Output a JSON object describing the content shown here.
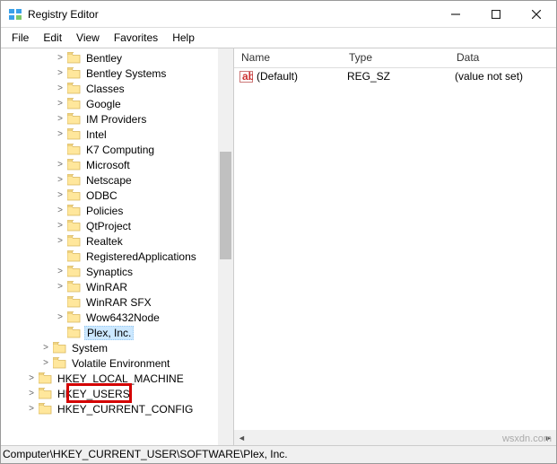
{
  "window": {
    "title": "Registry Editor"
  },
  "menubar": {
    "file": "File",
    "edit": "Edit",
    "view": "View",
    "favorites": "Favorites",
    "help": "Help"
  },
  "tree": {
    "items": [
      {
        "label": "Bentley",
        "expander": ">"
      },
      {
        "label": "Bentley Systems",
        "expander": ">"
      },
      {
        "label": "Classes",
        "expander": ">"
      },
      {
        "label": "Google",
        "expander": ">"
      },
      {
        "label": "IM Providers",
        "expander": ">"
      },
      {
        "label": "Intel",
        "expander": ">"
      },
      {
        "label": "K7 Computing",
        "expander": ""
      },
      {
        "label": "Microsoft",
        "expander": ">"
      },
      {
        "label": "Netscape",
        "expander": ">"
      },
      {
        "label": "ODBC",
        "expander": ">"
      },
      {
        "label": "Policies",
        "expander": ">"
      },
      {
        "label": "QtProject",
        "expander": ">"
      },
      {
        "label": "Realtek",
        "expander": ">"
      },
      {
        "label": "RegisteredApplications",
        "expander": ""
      },
      {
        "label": "Synaptics",
        "expander": ">"
      },
      {
        "label": "WinRAR",
        "expander": ">"
      },
      {
        "label": "WinRAR SFX",
        "expander": ""
      },
      {
        "label": "Wow6432Node",
        "expander": ">"
      },
      {
        "label": "Plex, Inc.",
        "expander": "",
        "selected": true
      }
    ],
    "under": [
      {
        "label": "System",
        "expander": ">",
        "ind": "ind2"
      },
      {
        "label": "Volatile Environment",
        "expander": ">",
        "ind": "ind2"
      },
      {
        "label": "HKEY_LOCAL_MACHINE",
        "expander": ">",
        "ind": "ind1"
      },
      {
        "label": "HKEY_USERS",
        "expander": ">",
        "ind": "ind1"
      },
      {
        "label": "HKEY_CURRENT_CONFIG",
        "expander": ">",
        "ind": "ind1"
      }
    ]
  },
  "list": {
    "headers": {
      "name": "Name",
      "type": "Type",
      "data": "Data"
    },
    "rows": [
      {
        "name": "(Default)",
        "type": "REG_SZ",
        "data": "(value not set)"
      }
    ]
  },
  "statusbar": {
    "path": "Computer\\HKEY_CURRENT_USER\\SOFTWARE\\Plex, Inc."
  },
  "watermark": "wsxdn.com"
}
